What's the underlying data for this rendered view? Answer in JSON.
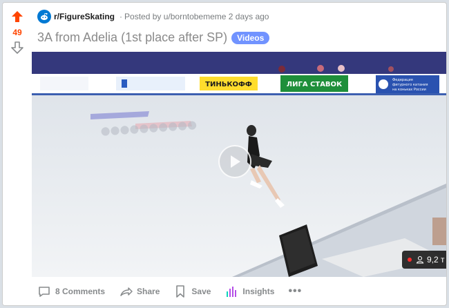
{
  "vote": {
    "score": "49",
    "upvoted": true,
    "accent": "#ff4500"
  },
  "post": {
    "subreddit": "r/FigureSkating",
    "separator": "·",
    "posted_by": "Posted by u/borntobememe 2 days ago",
    "title": "3A from Adelia (1st place after SP)",
    "flair": "Videos",
    "flair_color": "#7193ff"
  },
  "video": {
    "boards": {
      "ad1": "ТИНЬКОФФ",
      "ad2": "ЛИГА СТАВОК",
      "ad3_line1": "Федерация",
      "ad3_line2": "фигурного катания",
      "ad3_line3": "на коньках России"
    },
    "viewer_count": "9,2 т",
    "play_icon": "play-icon"
  },
  "actions": {
    "comments": "8 Comments",
    "share": "Share",
    "save": "Save",
    "insights": "Insights",
    "more": "•••"
  }
}
